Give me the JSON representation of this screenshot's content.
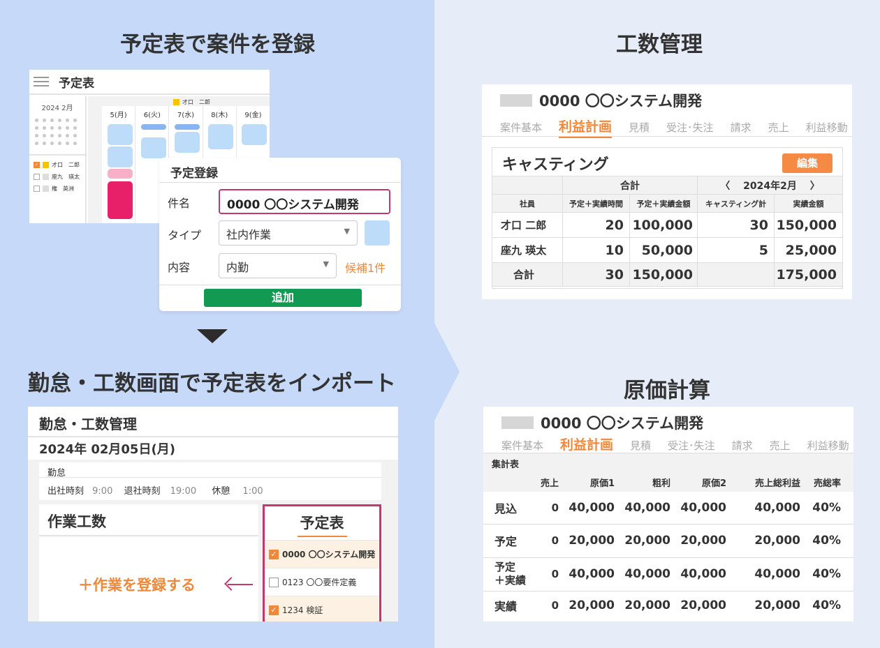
{
  "headings": {
    "top_left": "予定表で案件を登録",
    "bottom_left": "勤怠・工数画面で予定表をインポート",
    "top_right": "工数管理",
    "bottom_right": "原価計算"
  },
  "calendar": {
    "title": "予定表",
    "month": "2024 2月",
    "legend_user": "才口　二郎",
    "days": [
      "5(月)",
      "6(火)",
      "7(水)",
      "8(木)",
      "9(金)"
    ],
    "members": [
      "才口　二郎",
      "座九　瑛太",
      "権　英洲"
    ]
  },
  "modal": {
    "title": "予定登録",
    "name_label": "件名",
    "name_value": "0000 〇〇システム開発",
    "type_label": "タイプ",
    "type_value": "社内作業",
    "content_label": "内容",
    "content_value": "内勤",
    "candidates": "候補1件",
    "add_button": "追加"
  },
  "attendance": {
    "title": "勤怠・工数管理",
    "date": "2024年 02月05日(月)",
    "section": "勤怠",
    "in_label": "出社時刻",
    "in_value": "9:00",
    "out_label": "退社時刻",
    "out_value": "19:00",
    "break_label": "休憩",
    "break_value": "1:00",
    "work_title": "作業工数",
    "register_link": "＋作業を登録する",
    "schedule_title": "予定表",
    "schedule_items": [
      {
        "label": "0000 〇〇システム開発",
        "checked": true
      },
      {
        "label": "0123 〇〇要件定義",
        "checked": false
      },
      {
        "label": "1234 検証",
        "checked": true
      }
    ]
  },
  "effort": {
    "project": "0000 〇〇システム開発",
    "tabs": [
      "案件基本",
      "利益計画",
      "見積",
      "受注･失注",
      "請求",
      "売上",
      "利益移動"
    ],
    "active_tab": "利益計画",
    "section_title": "キャスティング",
    "edit_button": "編集",
    "group_total": "合計",
    "prev": "〈",
    "month": "2024年2月",
    "next": "〉",
    "columns": [
      "社員",
      "予定＋実績時間",
      "予定＋実績金額",
      "キャスティング計",
      "実績金額"
    ],
    "rows": [
      [
        "才口 二郎",
        "20",
        "100,000",
        "30",
        "150,000"
      ],
      [
        "座九 瑛太",
        "10",
        "50,000",
        "5",
        "25,000"
      ],
      [
        "合計",
        "30",
        "150,000",
        "",
        "175,000"
      ]
    ]
  },
  "cost": {
    "project": "0000 〇〇システム開発",
    "tabs": [
      "案件基本",
      "利益計画",
      "見積",
      "受注･失注",
      "請求",
      "売上",
      "利益移動"
    ],
    "active_tab": "利益計画",
    "section_title": "集計表",
    "columns": [
      "",
      "売上",
      "原価1",
      "粗利",
      "原価2",
      "売上総利益",
      "売総率"
    ],
    "rows": [
      [
        "見込",
        "0",
        "40,000",
        "40,000",
        "40,000",
        "40,000",
        "40%"
      ],
      [
        "予定",
        "0",
        "20,000",
        "20,000",
        "20,000",
        "20,000",
        "40%"
      ],
      [
        "予定\n＋実績",
        "0",
        "40,000",
        "40,000",
        "40,000",
        "40,000",
        "40%"
      ],
      [
        "実績",
        "0",
        "20,000",
        "20,000",
        "20,000",
        "20,000",
        "40%"
      ]
    ]
  }
}
